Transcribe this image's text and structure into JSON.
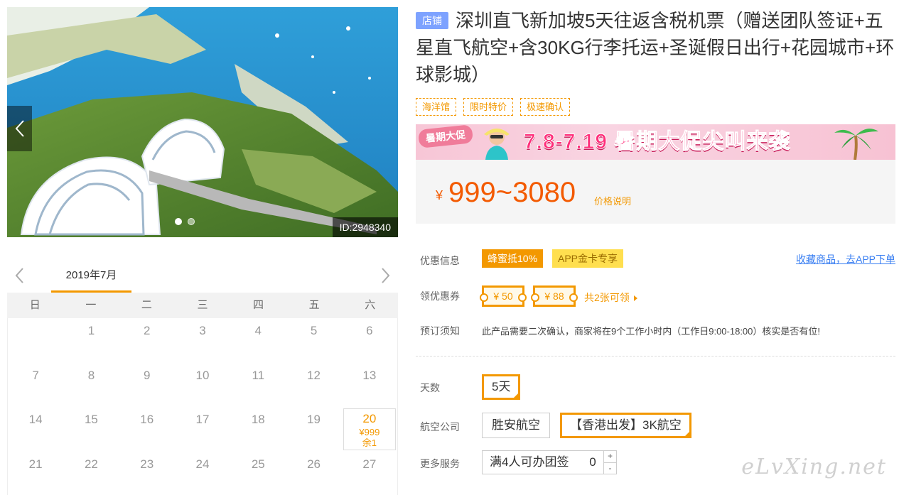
{
  "gallery": {
    "id_label": "ID:2948340",
    "prev_icon": "chevron-left-icon",
    "next_icon": "chevron-right-icon",
    "dot_count": 2
  },
  "calendar": {
    "month": "2019年7月",
    "weekdays": [
      "日",
      "一",
      "二",
      "三",
      "四",
      "五",
      "六"
    ],
    "rows": [
      [
        {
          "d": ""
        },
        {
          "d": "1"
        },
        {
          "d": "2"
        },
        {
          "d": "3"
        },
        {
          "d": "4"
        },
        {
          "d": "5"
        },
        {
          "d": "6"
        }
      ],
      [
        {
          "d": "7"
        },
        {
          "d": "8"
        },
        {
          "d": "9"
        },
        {
          "d": "10"
        },
        {
          "d": "11"
        },
        {
          "d": "12"
        },
        {
          "d": "13"
        }
      ],
      [
        {
          "d": "14"
        },
        {
          "d": "15"
        },
        {
          "d": "16"
        },
        {
          "d": "17"
        },
        {
          "d": "18"
        },
        {
          "d": "19"
        },
        {
          "d": "20",
          "price": "¥999",
          "left": "余1",
          "sel": true
        }
      ],
      [
        {
          "d": "21"
        },
        {
          "d": "22"
        },
        {
          "d": "23"
        },
        {
          "d": "24"
        },
        {
          "d": "25"
        },
        {
          "d": "26"
        },
        {
          "d": "27"
        }
      ]
    ]
  },
  "product": {
    "shop_badge": "店铺",
    "title": "深圳直飞新加坡5天往返含税机票（赠送团队签证+五星直飞航空+含30KG行李托运+圣诞假日出行+花园城市+环球影城）",
    "tags": [
      "海洋馆",
      "限时特价",
      "极速确认"
    ]
  },
  "promo": {
    "tag": "暑期大促",
    "text": "7.8-7.19 暑期大促尖叫来袭"
  },
  "price": {
    "symbol": "¥",
    "value": "999~3080",
    "note": "价格说明"
  },
  "discount": {
    "label": "优惠信息",
    "badge1": "蜂蜜抵10%",
    "badge2": "APP金卡专享",
    "fav_link": "收藏商品，去APP下单"
  },
  "coupons": {
    "label": "领优惠券",
    "c1": "¥ 50",
    "c2": "¥ 88",
    "more": "共2张可领"
  },
  "booking": {
    "label": "预订须知",
    "text": "此产品需要二次确认，商家将在9个工作小时内（工作日9:00-18:00）核实是否有位!"
  },
  "options": {
    "days_label": "天数",
    "days_value": "5天",
    "airline_label": "航空公司",
    "airline_1": "胜安航空",
    "airline_2": "【香港出发】3K航空",
    "service_label": "更多服务",
    "service_name": "满4人可办团签",
    "service_qty": "0",
    "plus": "+",
    "minus": "-"
  },
  "watermark": "eLvXing.net",
  "colors": {
    "accent": "#f39800",
    "price": "#f35a00",
    "link": "#3a7ff2",
    "badge_blue": "#7da2ff"
  }
}
